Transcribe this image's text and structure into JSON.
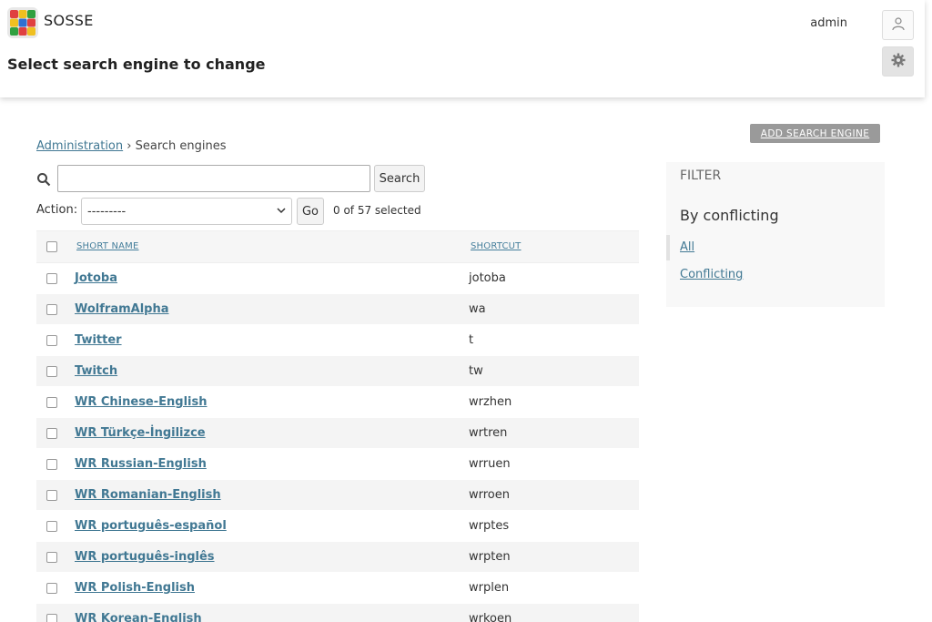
{
  "header": {
    "brand": "SOSSE",
    "page_title": "Select search engine to change",
    "user": "admin"
  },
  "toolbar": {
    "add_label": "ADD SEARCH ENGINE"
  },
  "breadcrumb": {
    "root": "Administration",
    "separator": "›",
    "current": "Search engines"
  },
  "search": {
    "value": "",
    "button_label": "Search"
  },
  "actions": {
    "label": "Action:",
    "selected_option": "---------",
    "go_label": "Go",
    "selected_count": "0 of 57 selected"
  },
  "table": {
    "columns": [
      "SHORT NAME",
      "SHORTCUT"
    ],
    "rows": [
      {
        "name": "Jotoba",
        "shortcut": "jotoba"
      },
      {
        "name": "WolframAlpha",
        "shortcut": "wa"
      },
      {
        "name": "Twitter",
        "shortcut": "t"
      },
      {
        "name": "Twitch",
        "shortcut": "tw"
      },
      {
        "name": "WR Chinese-English",
        "shortcut": "wrzhen"
      },
      {
        "name": "WR Türkçe-İngilizce",
        "shortcut": "wrtren"
      },
      {
        "name": "WR Russian-English",
        "shortcut": "wrruen"
      },
      {
        "name": "WR Romanian-English",
        "shortcut": "wrroen"
      },
      {
        "name": "WR português-español",
        "shortcut": "wrptes"
      },
      {
        "name": "WR português-inglês",
        "shortcut": "wrpten"
      },
      {
        "name": "WR Polish-English",
        "shortcut": "wrplen"
      },
      {
        "name": "WR Korean-English",
        "shortcut": "wrkoen"
      }
    ]
  },
  "filter": {
    "title": "FILTER",
    "by": "By conflicting",
    "options": [
      "All",
      "Conflicting"
    ]
  },
  "colors": {
    "link": "#417893",
    "add_button": "#9a9a9a"
  }
}
